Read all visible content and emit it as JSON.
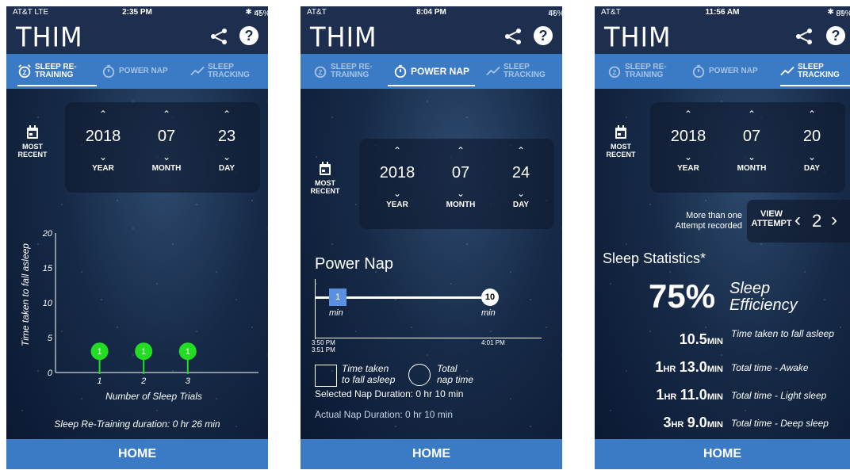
{
  "phones": [
    {
      "status": {
        "carrier": "AT&T  LTE",
        "time": "2:35 PM",
        "battery": "45%"
      },
      "logo": "THIM",
      "tabs": [
        {
          "label1": "SLEEP RE-",
          "label2": "TRAINING"
        },
        {
          "label1": "POWER NAP",
          "label2": ""
        },
        {
          "label1": "SLEEP",
          "label2": "TRACKING"
        }
      ],
      "active_tab": 0,
      "most_recent": {
        "l1": "MOST",
        "l2": "RECENT"
      },
      "date": {
        "year": "2018",
        "month": "07",
        "day": "23",
        "year_label": "YEAR",
        "month_label": "MONTH",
        "day_label": "DAY"
      },
      "chart_data": {
        "type": "scatter",
        "title": "",
        "xlabel": "Number of Sleep Trials",
        "ylabel": "Time taken to fall asleep",
        "x": [
          1,
          2,
          3
        ],
        "y": [
          1,
          1,
          1
        ],
        "point_labels": [
          "1",
          "1",
          "1"
        ],
        "xticks": [
          "1",
          "2",
          "3"
        ],
        "yticks": [
          "0",
          "5",
          "10",
          "15",
          "20"
        ],
        "ylim": [
          0,
          20
        ],
        "xlim": [
          0,
          7
        ],
        "point_color": "#22dd22"
      },
      "footer_note": "Sleep Re-Training duration: 0 hr 26 min",
      "home": "HOME"
    },
    {
      "status": {
        "carrier": "AT&T",
        "time": "8:04 PM",
        "battery": "46%"
      },
      "logo": "THIM",
      "tabs": [
        {
          "label1": "SLEEP RE-",
          "label2": "TRAINING"
        },
        {
          "label1": "POWER NAP",
          "label2": ""
        },
        {
          "label1": "SLEEP",
          "label2": "TRACKING"
        }
      ],
      "active_tab": 1,
      "most_recent": {
        "l1": "MOST",
        "l2": "RECENT"
      },
      "date": {
        "year": "2018",
        "month": "07",
        "day": "24",
        "year_label": "YEAR",
        "month_label": "MONTH",
        "day_label": "DAY"
      },
      "section_title": "Power Nap",
      "nap": {
        "start_value": "1",
        "start_unit": "min",
        "end_value": "10",
        "end_unit": "min",
        "start_time_1": "3:50 PM",
        "start_time_2": "3:51 PM",
        "end_time": "4:01 PM",
        "legend_square_1": "Time taken",
        "legend_square_2": "to fall asleep",
        "legend_circle_1": "Total",
        "legend_circle_2": "nap time",
        "selected": "Selected Nap Duration: 0 hr 10 min",
        "actual": "Actual Nap Duration: 0 hr 10 min"
      },
      "home": "HOME"
    },
    {
      "status": {
        "carrier": "AT&T",
        "time": "11:56 AM",
        "battery": "89%"
      },
      "logo": "THIM",
      "tabs": [
        {
          "label1": "SLEEP RE-",
          "label2": "TRAINING"
        },
        {
          "label1": "POWER NAP",
          "label2": ""
        },
        {
          "label1": "SLEEP",
          "label2": "TRACKING"
        }
      ],
      "active_tab": 2,
      "most_recent": {
        "l1": "MOST",
        "l2": "RECENT"
      },
      "date": {
        "year": "2018",
        "month": "07",
        "day": "20",
        "year_label": "YEAR",
        "month_label": "MONTH",
        "day_label": "DAY"
      },
      "attempt": {
        "note1": "More than one",
        "note2": "Attempt recorded",
        "view1": "VIEW",
        "view2": "ATTEMPT",
        "value": "2"
      },
      "stats_title": "Sleep Statistics*",
      "efficiency": {
        "value": "75%",
        "label1": "Sleep",
        "label2": "Efficiency"
      },
      "rows": [
        {
          "hr": "",
          "hr_unit": "",
          "min": "10.5",
          "min_unit": "MIN",
          "label": "Time taken to fall asleep"
        },
        {
          "hr": "1",
          "hr_unit": "HR",
          "min": "13.0",
          "min_unit": "MIN",
          "label": "Total time - Awake"
        },
        {
          "hr": "1",
          "hr_unit": "HR",
          "min": "11.0",
          "min_unit": "MIN",
          "label": "Total time - Light sleep"
        },
        {
          "hr": "3",
          "hr_unit": "HR",
          "min": "9.0",
          "min_unit": "MIN",
          "label": "Total time - Deep sleep"
        }
      ],
      "home": "HOME"
    }
  ]
}
